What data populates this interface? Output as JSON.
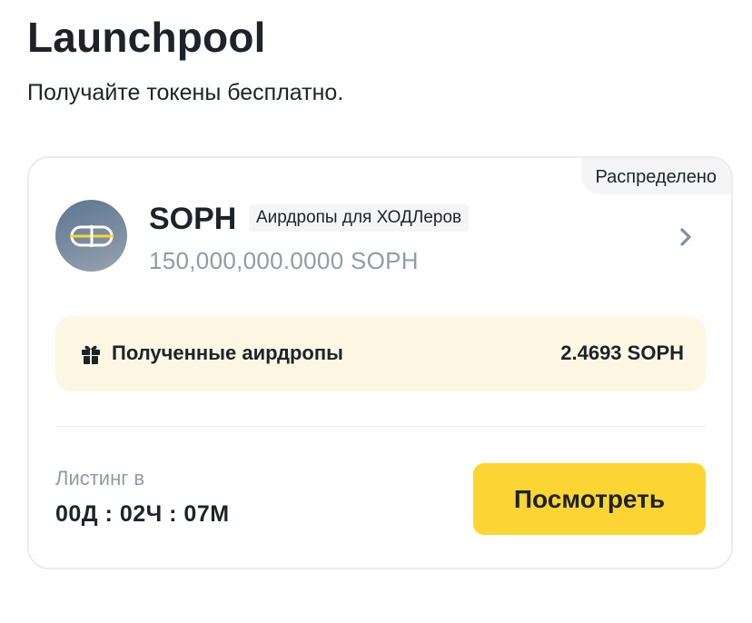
{
  "header": {
    "title": "Launchpool",
    "subtitle": "Получайте токены бесплатно."
  },
  "card": {
    "status_badge": "Распределено",
    "token": {
      "name": "SOPH",
      "tag": "Аирдропы для ХОДЛеров",
      "amount": "150,000,000.0000 SOPH",
      "logo_icon": "soph-logo-icon"
    },
    "airdrops": {
      "icon": "gift-icon",
      "label": "Полученные аирдропы",
      "value": "2.4693 SOPH"
    },
    "listing": {
      "label": "Листинг в",
      "countdown": "00Д : 02Ч : 07М"
    },
    "view_button_label": "Посмотреть"
  },
  "colors": {
    "accent": "#fcd535",
    "panel_bg": "#fdf6e3",
    "text_primary": "#1e2329",
    "text_secondary": "#929aa5"
  }
}
